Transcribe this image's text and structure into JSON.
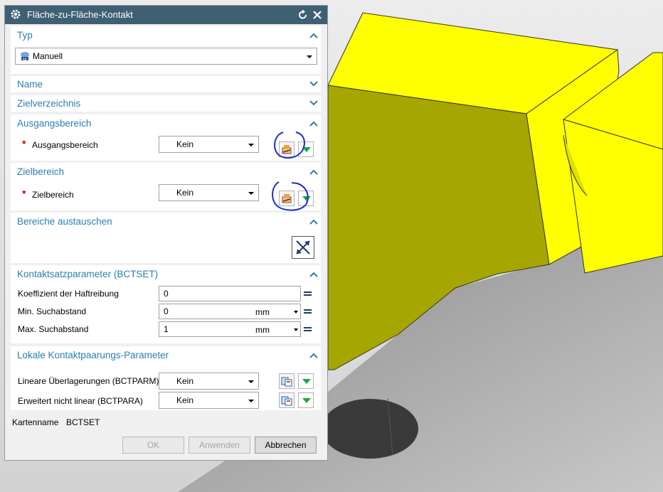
{
  "dialog": {
    "title": "Fläche-zu-Fläche-Kontakt",
    "sections": {
      "typ": {
        "title": "Typ",
        "value": "Manuell"
      },
      "name": {
        "title": "Name"
      },
      "zielverzeichnis": {
        "title": "Zielverzeichnis"
      },
      "ausgangsbereich": {
        "title": "Ausgangsbereich",
        "label": "Ausgangsbereich",
        "value": "Kein"
      },
      "zielbereich": {
        "title": "Zielbereich",
        "label": "Zielbereich",
        "value": "Kein"
      },
      "austauschen": {
        "title": "Bereiche austauschen"
      },
      "kontaktsatz": {
        "title": "Kontaktsatzparameter (BCTSET)",
        "rows": [
          {
            "label": "Koeffizient der Haftreibung",
            "value": "0",
            "unit": ""
          },
          {
            "label": "Min. Suchabstand",
            "value": "0",
            "unit": "mm"
          },
          {
            "label": "Max. Suchabstand",
            "value": "1",
            "unit": "mm"
          }
        ]
      },
      "lokal": {
        "title": "Lokale Kontaktpaarungs-Parameter",
        "rows": [
          {
            "label": "Lineare Überlagerungen (BCTPARM)",
            "value": "Kein"
          },
          {
            "label": "Erweitert nicht linear (BCTPARA)",
            "value": "Kein"
          }
        ]
      }
    },
    "card": {
      "label": "Kartenname",
      "value": "BCTSET"
    },
    "buttons": {
      "ok": "OK",
      "apply": "Anwenden",
      "cancel": "Abbrechen"
    }
  },
  "colors": {
    "title_bar": "#3f5f73",
    "section_title": "#2a7fb0",
    "model_yellow": "#ffff00",
    "model_olive": "#a6a600",
    "annotation": "#1a2fd6"
  }
}
